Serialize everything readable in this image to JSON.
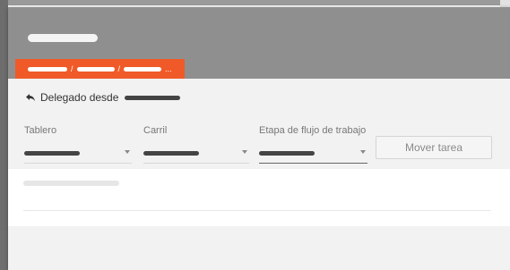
{
  "delegation": {
    "label": "Delegado desde"
  },
  "fields": [
    {
      "label": "Tablero"
    },
    {
      "label": "Carril"
    },
    {
      "label": "Etapa de flujo de trabajo"
    }
  ],
  "actions": {
    "move_task": "Mover tarea"
  },
  "breadcrumb": {
    "separator": "/",
    "ellipsis": "..."
  },
  "colors": {
    "header": "#8f8f8f",
    "breadcrumb_accent": "#f05a28",
    "panel": "#f2f2f2",
    "card": "#ffffff"
  },
  "icons": {
    "delegation": "reply-arrow-icon",
    "dropdown": "caret-down-icon"
  }
}
